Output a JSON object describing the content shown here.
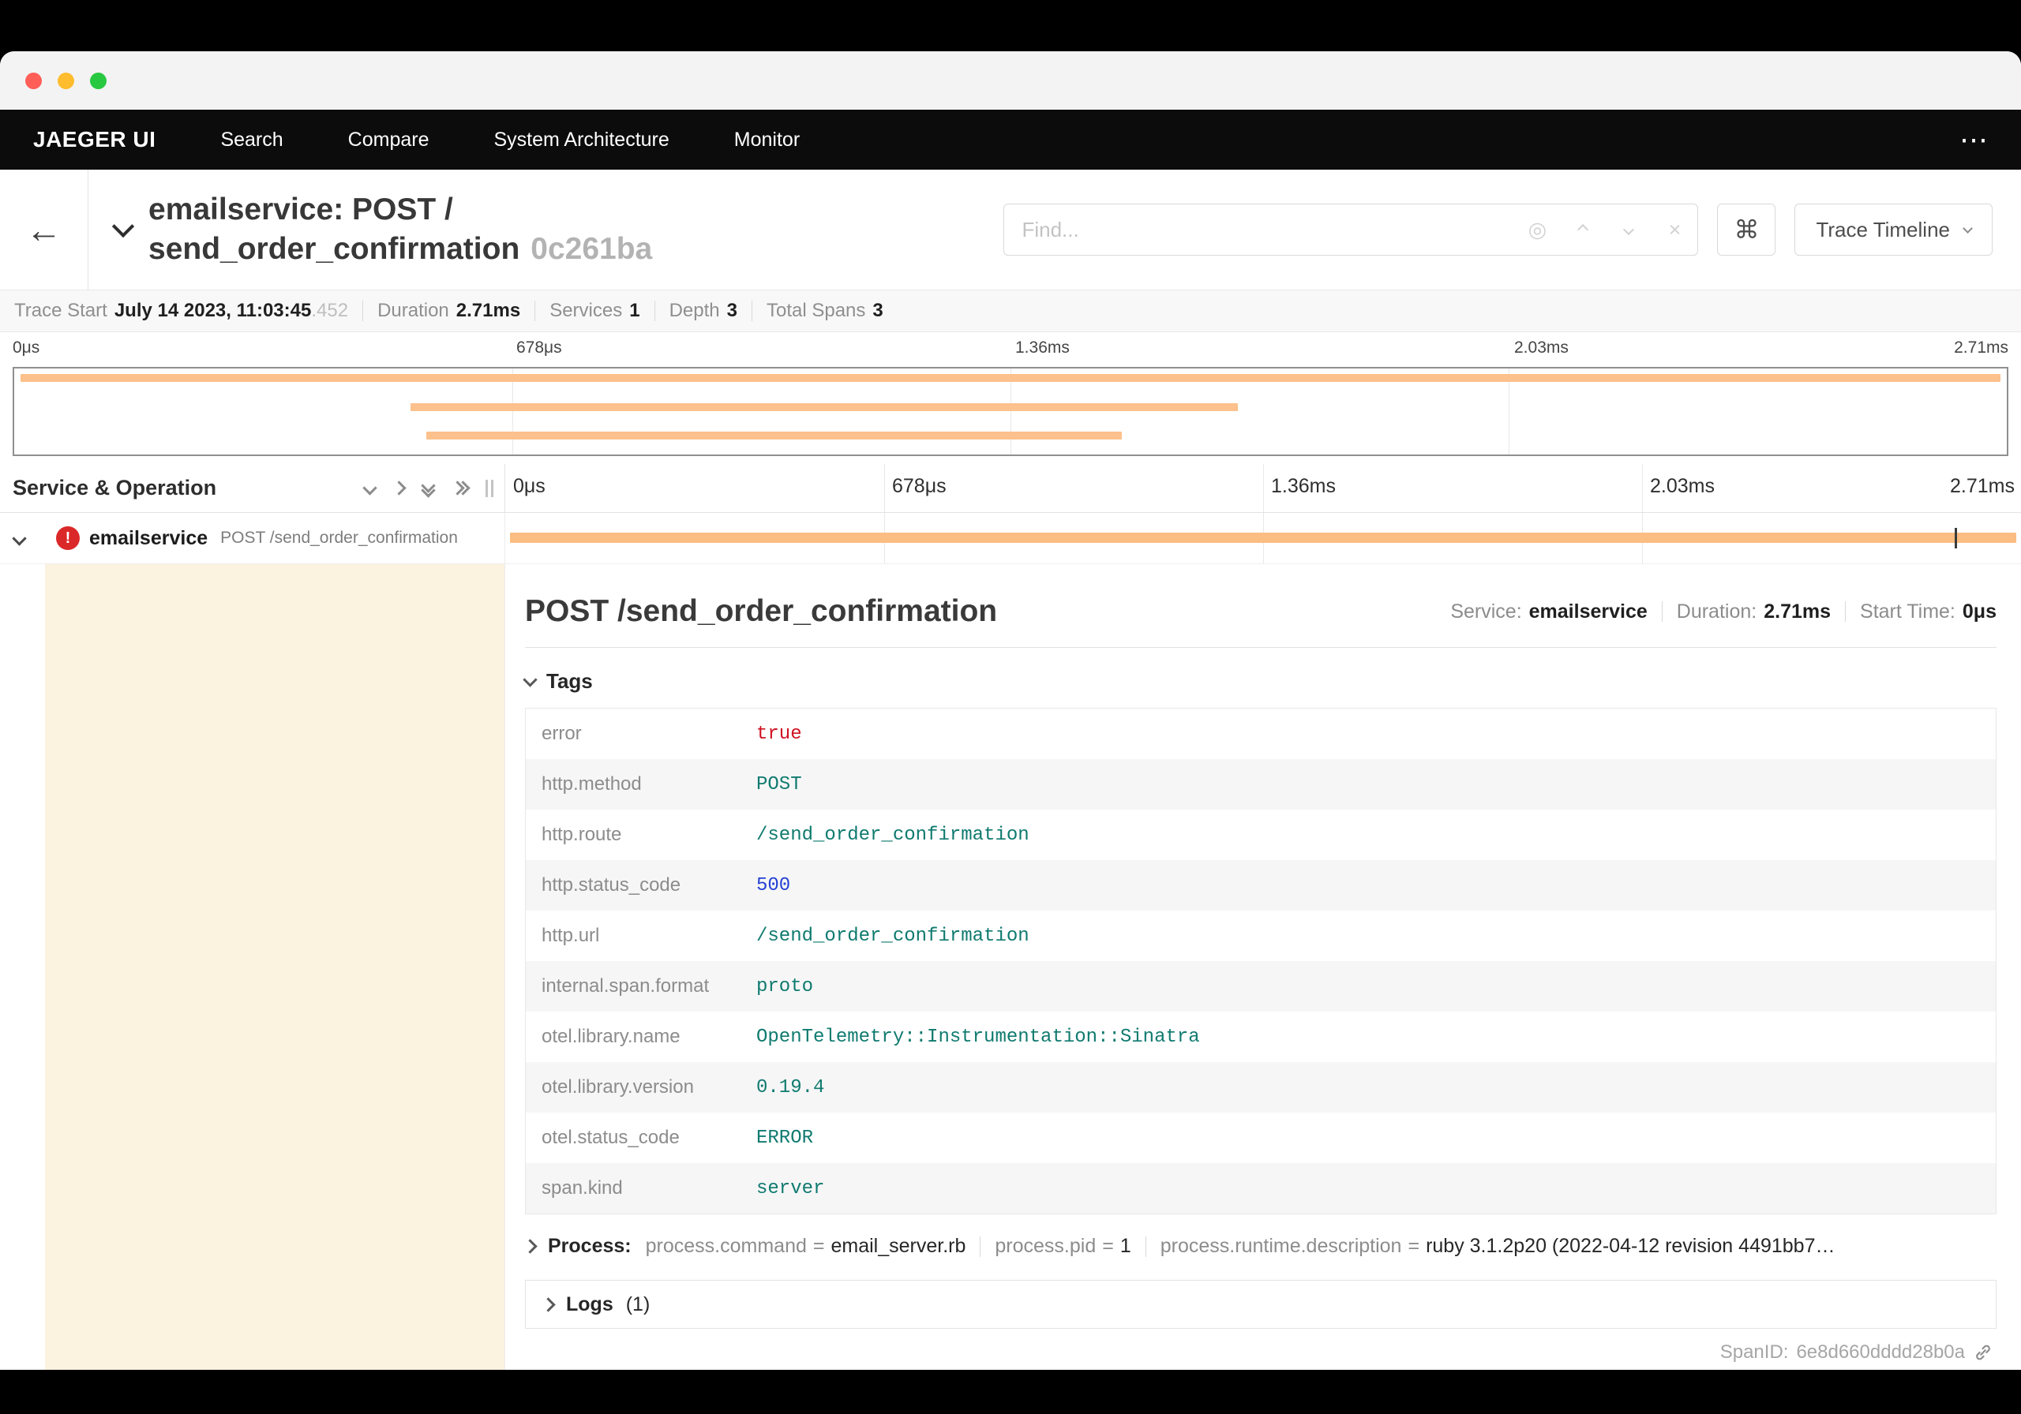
{
  "nav": {
    "brand": "JAEGER UI",
    "items": [
      "Search",
      "Compare",
      "System Architecture",
      "Monitor"
    ]
  },
  "icons": {
    "back": "←",
    "command": "⌘",
    "locate": "◎",
    "clear": "×",
    "overflow": "⋯",
    "error_mark": "!"
  },
  "header": {
    "title_line1": "emailservice: POST /",
    "title_line2": "send_order_confirmation",
    "trace_id": "0c261ba",
    "find_placeholder": "Find...",
    "view_mode": "Trace Timeline"
  },
  "summary": {
    "trace_start_label": "Trace Start",
    "trace_start_value": "July 14 2023, 11:03:45",
    "trace_start_ms": ".452",
    "duration_label": "Duration",
    "duration_value": "2.71ms",
    "services_label": "Services",
    "services_value": "1",
    "depth_label": "Depth",
    "depth_value": "3",
    "spans_label": "Total Spans",
    "spans_value": "3"
  },
  "ticks": [
    "0μs",
    "678μs",
    "1.36ms",
    "2.03ms",
    "2.71ms"
  ],
  "timeline": {
    "left_header": "Service & Operation",
    "row": {
      "service": "emailservice",
      "operation": "POST /send_order_confirmation"
    }
  },
  "bars": [
    {
      "left": "0.3%",
      "width": "99.4%"
    },
    {
      "left": "19.9%",
      "width": "41.5%"
    },
    {
      "left": "20.7%",
      "width": "34.9%"
    },
    {
      "left": "0.3%",
      "width": "99.4%"
    }
  ],
  "marker_left": "95.6%",
  "detail": {
    "title": "POST /send_order_confirmation",
    "service_label": "Service:",
    "service_value": "emailservice",
    "duration_label": "Duration:",
    "duration_value": "2.71ms",
    "start_label": "Start Time:",
    "start_value": "0μs",
    "tags_header": "Tags",
    "tags": [
      {
        "key": "error",
        "value": "true"
      },
      {
        "key": "http.method",
        "value": "POST"
      },
      {
        "key": "http.route",
        "value": "/send_order_confirmation"
      },
      {
        "key": "http.status_code",
        "value": "500"
      },
      {
        "key": "http.url",
        "value": "/send_order_confirmation"
      },
      {
        "key": "internal.span.format",
        "value": "proto"
      },
      {
        "key": "otel.library.name",
        "value": "OpenTelemetry::Instrumentation::Sinatra"
      },
      {
        "key": "otel.library.version",
        "value": "0.19.4"
      },
      {
        "key": "otel.status_code",
        "value": "ERROR"
      },
      {
        "key": "span.kind",
        "value": "server"
      }
    ],
    "process_header": "Process:",
    "process_eq": "=",
    "process": [
      {
        "key": "process.command",
        "value": "email_server.rb"
      },
      {
        "key": "process.pid",
        "value": "1"
      },
      {
        "key": "process.runtime.description",
        "value": "ruby 3.1.2p20 (2022-04-12 revision 4491bb7…"
      }
    ],
    "logs_header": "Logs",
    "logs_count": "(1)",
    "span_id_label": "SpanID:",
    "span_id_value": "6e8d660dddd28b0a"
  },
  "colors": {
    "nav_bg": "#0c0c0c",
    "span_bar": "#fbbd82",
    "minimap_bar": "#fcc18c",
    "indent_band": "#fbf2e0",
    "error_red": "#db2828",
    "value_string": "#0f7a6f",
    "value_number": "#2440d4",
    "value_bool": "#cf1322"
  }
}
